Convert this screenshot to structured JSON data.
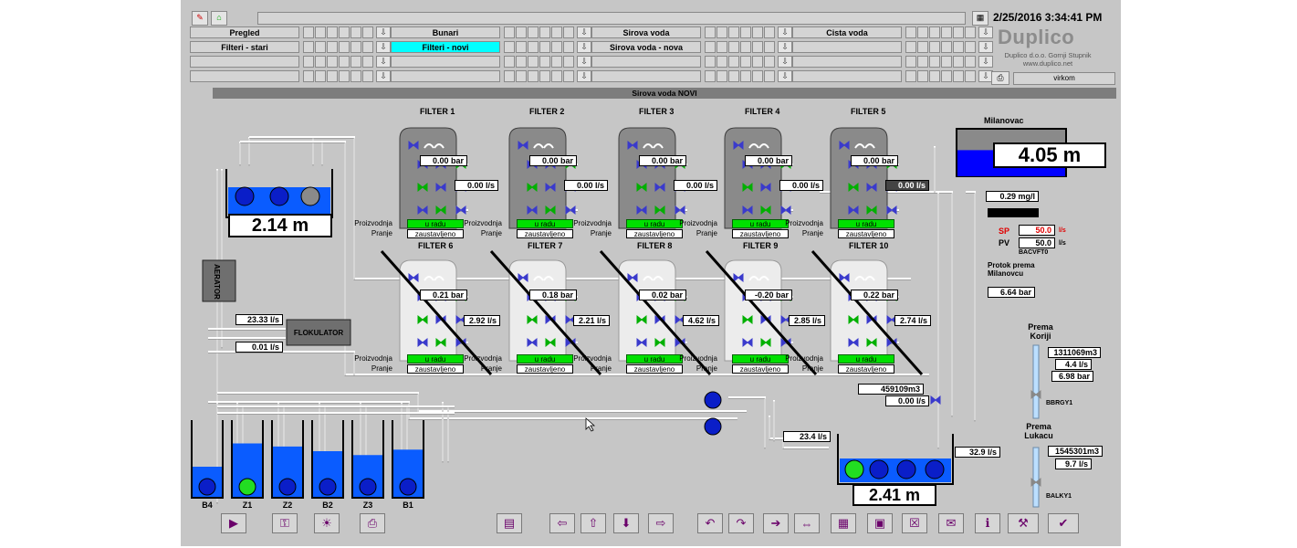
{
  "header": {
    "datetime": "2/25/2016 3:34:41 PM",
    "logo": "Duplico",
    "company": "Duplico d.o.o. Gornji Stupnik",
    "website": "www.duplico.net",
    "user": "virkom",
    "nav_row1": [
      "Pregled",
      "Bunari",
      "Sirova voda",
      "Cista voda"
    ],
    "nav_row2": [
      "Filteri - stari",
      "Filteri - novi",
      "Sirova voda - nova",
      ""
    ],
    "active_tab": "Filteri - novi",
    "down_arrow": "⇩"
  },
  "screen_title": "Sirova voda NOVI",
  "top_filters": [
    {
      "name": "FILTER 1",
      "pressure": "0.00 bar",
      "flow": "0.00 l/s",
      "status": "u radu",
      "pranje": "zaustavljeno"
    },
    {
      "name": "FILTER 2",
      "pressure": "0.00 bar",
      "flow": "0.00 l/s",
      "status": "u radu",
      "pranje": "zaustavljeno"
    },
    {
      "name": "FILTER 3",
      "pressure": "0.00 bar",
      "flow": "0.00 l/s",
      "status": "u radu",
      "pranje": "zaustavljeno"
    },
    {
      "name": "FILTER 4",
      "pressure": "0.00 bar",
      "flow": "0.00 l/s",
      "status": "u radu",
      "pranje": "zaustavljeno"
    },
    {
      "name": "FILTER 5",
      "pressure": "0.00 bar",
      "flow": "0.00 l/s",
      "status": "u radu",
      "pranje": "zaustavljeno"
    }
  ],
  "bottom_filters": [
    {
      "name": "FILTER 6",
      "pressure": "0.21 bar",
      "flow": "2.92 l/s",
      "status": "u radu",
      "pranje": "zaustavljeno"
    },
    {
      "name": "FILTER 7",
      "pressure": "0.18 bar",
      "flow": "2.21 l/s",
      "status": "u radu",
      "pranje": "zaustavljeno"
    },
    {
      "name": "FILTER 8",
      "pressure": "0.02 bar",
      "flow": "4.62 l/s",
      "status": "u radu",
      "pranje": "zaustavljeno"
    },
    {
      "name": "FILTER 9",
      "pressure": "-0.20 bar",
      "flow": "2.85 l/s",
      "status": "u radu",
      "pranje": "zaustavljeno"
    },
    {
      "name": "FILTER 10",
      "pressure": "0.22 bar",
      "flow": "2.74 l/s",
      "status": "u radu",
      "pranje": "zaustavljeno"
    }
  ],
  "labels": {
    "proizvodnja": "Proizvodnja",
    "pranje": "Pranje"
  },
  "left": {
    "tank_level": "2.14 m",
    "aerator": "AERATOR",
    "flokulator": "FLOKULATOR",
    "flow1": "23.33 l/s",
    "flow2": "0.01 l/s"
  },
  "wells": [
    "B4",
    "Z1",
    "Z2",
    "B2",
    "Z3",
    "B1"
  ],
  "wells_fill": [
    0.4,
    0.7,
    0.66,
    0.6,
    0.55,
    0.62
  ],
  "center": {
    "volume": "459109m3",
    "flow_zero": "0.00 l/s",
    "flow_in": "23.4 l/s",
    "flow_out": "32.9 l/s",
    "clear_tank_level": "2.41 m"
  },
  "right": {
    "milanovac": "Milanovac",
    "milanovac_level": "4.05 m",
    "milanovac_fill": 0.55,
    "chlorine": "0.29 mg/l",
    "sp_label": "SP",
    "sp_value": "50.0",
    "pv_label": "PV",
    "pv_value": "50.0",
    "unit_ls": "l/s",
    "tag1": "BACVFT0",
    "protok_title": "Protok prema Milanovcu",
    "protok_value": "6.64 bar",
    "koriji_title": "Prema Koriji",
    "koriji_volume": "1311069m3",
    "koriji_flow": "4.4 l/s",
    "koriji_pressure": "6.98 bar",
    "koriji_tag": "BBRGY1",
    "lukacu_title": "Prema Lukacu",
    "lukacu_volume": "1545301m3",
    "lukacu_flow": "9.7 l/s",
    "lukacu_tag": "BALKY1"
  },
  "toolbar": [
    "play-icon",
    "key-icon",
    "sun-icon",
    "printer-icon",
    "report-icon",
    "back-icon",
    "home-icon",
    "down-icon",
    "forward-icon",
    "undo-icon",
    "redo-icon",
    "arrow-dot-icon",
    "double-arrow-icon",
    "trend-icon",
    "alarm-icon",
    "close-alarm-icon",
    "info-icon",
    "help-icon",
    "tools-icon",
    "exit-icon"
  ],
  "colors": {
    "water": "#0a5cff",
    "active": "#00ffff",
    "running": "#00e000",
    "valve": "#3a3acc",
    "valve_green": "#00b000"
  }
}
